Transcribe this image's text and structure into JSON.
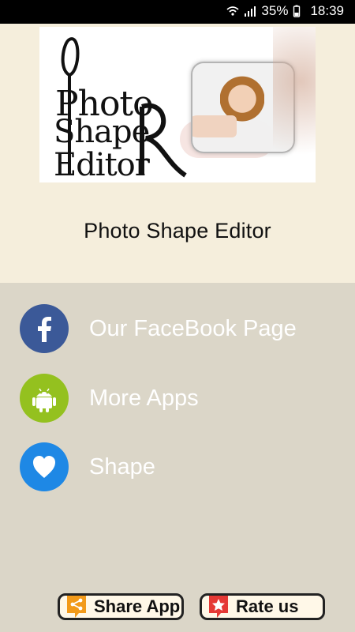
{
  "status_bar": {
    "battery": "35%",
    "time": "18:39"
  },
  "app": {
    "title": "Photo Shape Editor",
    "banner_text": [
      "Photo",
      "Shape",
      "Editor"
    ]
  },
  "menu": {
    "items": [
      {
        "label": "Our FaceBook Page",
        "icon": "facebook-icon"
      },
      {
        "label": "More Apps",
        "icon": "android-icon"
      },
      {
        "label": "Shape",
        "icon": "heart-icon"
      }
    ]
  },
  "buttons": {
    "share": "Share App",
    "rate": "Rate us"
  },
  "colors": {
    "status_bar": "#000000",
    "top_bg": "#f5eedc",
    "main_bg": "#dbd6c8",
    "facebook_blue": "#3b5998",
    "android_green": "#94c11f",
    "heart_blue": "#1e88e5",
    "share_orange": "#f29a1a",
    "rate_red": "#e53935"
  }
}
